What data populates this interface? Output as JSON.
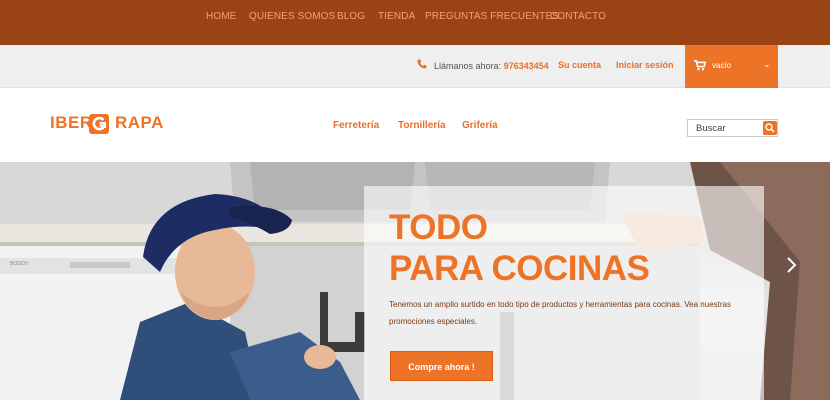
{
  "topnav": {
    "items": [
      "HOME",
      "QUIENES SOMOS",
      "BLOG",
      "TIENDA",
      "PREGUNTAS FRECUENTES",
      "CONTACTO"
    ]
  },
  "infobar": {
    "call_label": "Llámanos ahora:",
    "phone": "976343454",
    "account": "Su cuenta",
    "login": "Iniciar sesión",
    "cart_label": "vacío"
  },
  "header": {
    "logo_left": "IBER",
    "logo_right": "RAPA",
    "categories": [
      "Ferretería",
      "Tornillería",
      "Grifería"
    ],
    "search_placeholder": "Buscar"
  },
  "hero": {
    "title_line1": "TODO",
    "title_line2": "PARA COCINAS",
    "description": "Tenemos un amplio surtido en todo tipo de productos y herramientas para cocinas. Vea nuestras promociones especiales.",
    "cta": "Compre ahora !"
  },
  "colors": {
    "brand_orange": "#ed7327",
    "topbar_brown": "#9a4416"
  }
}
